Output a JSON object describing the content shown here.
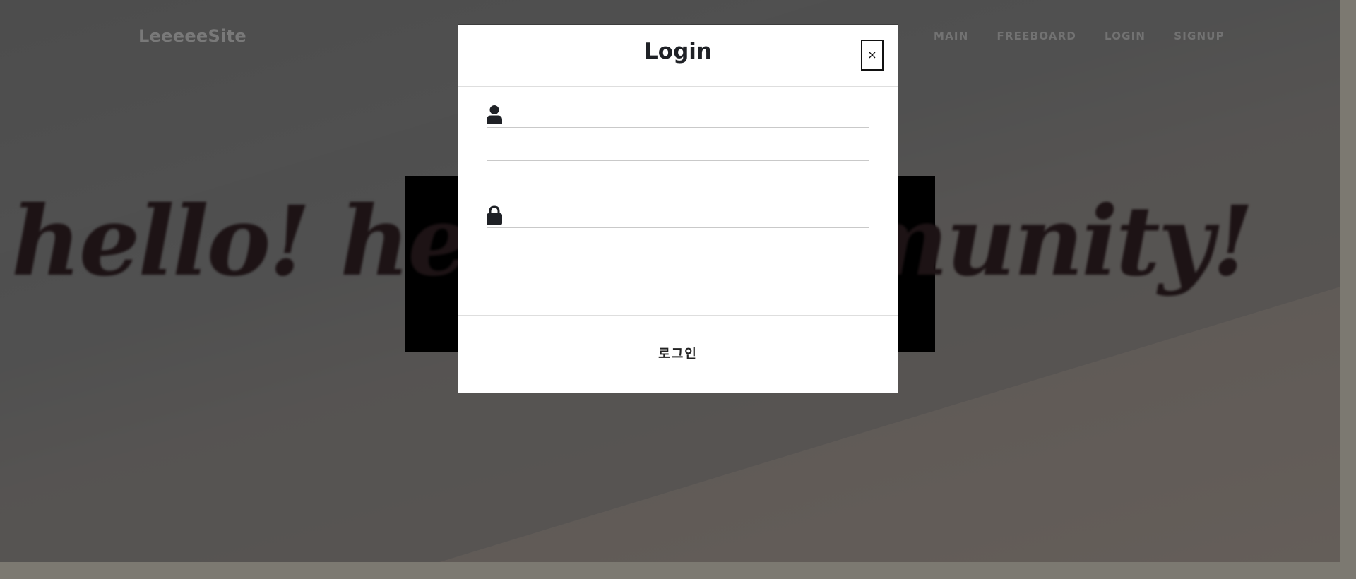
{
  "site": {
    "brand": "LeeeeeSite",
    "nav": [
      {
        "label": "MAIN"
      },
      {
        "label": "FREEBOARD"
      },
      {
        "label": "LOGIN"
      },
      {
        "label": "SIGNUP"
      }
    ],
    "hero_text": "hello! hello community!"
  },
  "modal": {
    "title": "Login",
    "close_label": "×",
    "fields": {
      "username": {
        "icon": "user-icon",
        "value": ""
      },
      "password": {
        "icon": "lock-icon",
        "value": ""
      }
    },
    "submit_label": "로그인"
  },
  "colors": {
    "backdrop": "rgba(0,0,0,0.5)",
    "modal_bg": "#ffffff",
    "title_text": "#1f2126",
    "icon": "#1f2126"
  }
}
